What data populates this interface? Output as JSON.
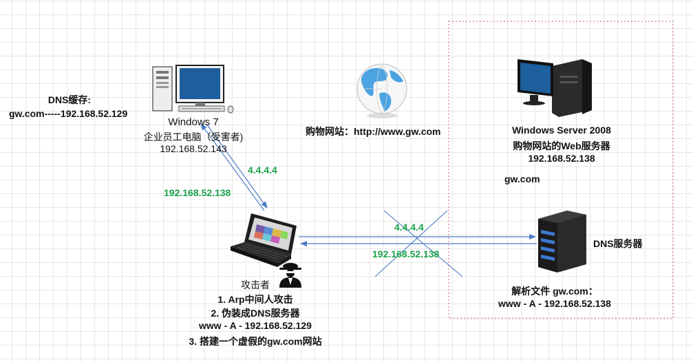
{
  "dns_cache": {
    "title": "DNS缓存:",
    "entry": "gw.com-----192.168.52.129"
  },
  "victim": {
    "name": "Windows 7",
    "role": "企业员工电脑（受害者)",
    "ip": "192.168.52.143",
    "icon": "desktop-pc-icon"
  },
  "website": {
    "label": "购物网站：http://www.gw.com",
    "icon": "globe-icon"
  },
  "web_server": {
    "name": "Windows Server 2008",
    "role": "购物网站的Web服务器",
    "ip": "192.168.52.138",
    "domain": "gw.com",
    "icon": "server-pc-icon"
  },
  "dns_server": {
    "name": "DNS服务器",
    "record_title": "解析文件 gw.com：",
    "record": "www - A - 192.168.52.138",
    "icon": "tower-server-icon"
  },
  "attacker": {
    "title": "攻击者",
    "steps": [
      "1. Arp中间人攻击",
      "2. 伪装成DNS服务器",
      "www - A - 192.168.52.129",
      "3. 搭建一个虚假的gw.com网站"
    ],
    "icon": "laptop-icon",
    "hacker_icon": "hacker-icon"
  },
  "links": {
    "victim_to_attacker": "4.4.4.4",
    "attacker_to_victim": "192.168.52.138",
    "attacker_to_dns": "4.4.4.4",
    "dns_to_attacker": "192.168.52.138"
  },
  "colors": {
    "arrow": "#4a7bc4",
    "label": "#1aa34a",
    "boundary": "#d9778a"
  }
}
